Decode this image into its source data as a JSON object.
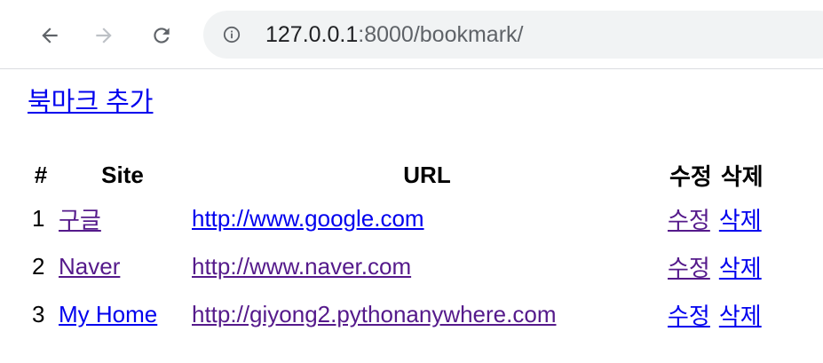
{
  "browser": {
    "url_host": "127.0.0.1",
    "url_rest": ":8000/bookmark/"
  },
  "page": {
    "add_link": "북마크 추가",
    "table": {
      "headers": [
        "#",
        "Site",
        "URL",
        "수정",
        "삭제"
      ],
      "rows": [
        {
          "num": "1",
          "site": "구글",
          "url": "http://www.google.com",
          "edit": "수정",
          "delete": "삭제"
        },
        {
          "num": "2",
          "site": "Naver",
          "url": "http://www.naver.com",
          "edit": "수정",
          "delete": "삭제"
        },
        {
          "num": "3",
          "site": "My Home",
          "url": "http://giyong2.pythonanywhere.com",
          "edit": "수정",
          "delete": "삭제"
        }
      ]
    }
  },
  "colors": {
    "link": "#0000ee",
    "visited_link": "#551a8b",
    "omnibox_bg": "#f1f3f4",
    "icon": "#5f6368"
  }
}
